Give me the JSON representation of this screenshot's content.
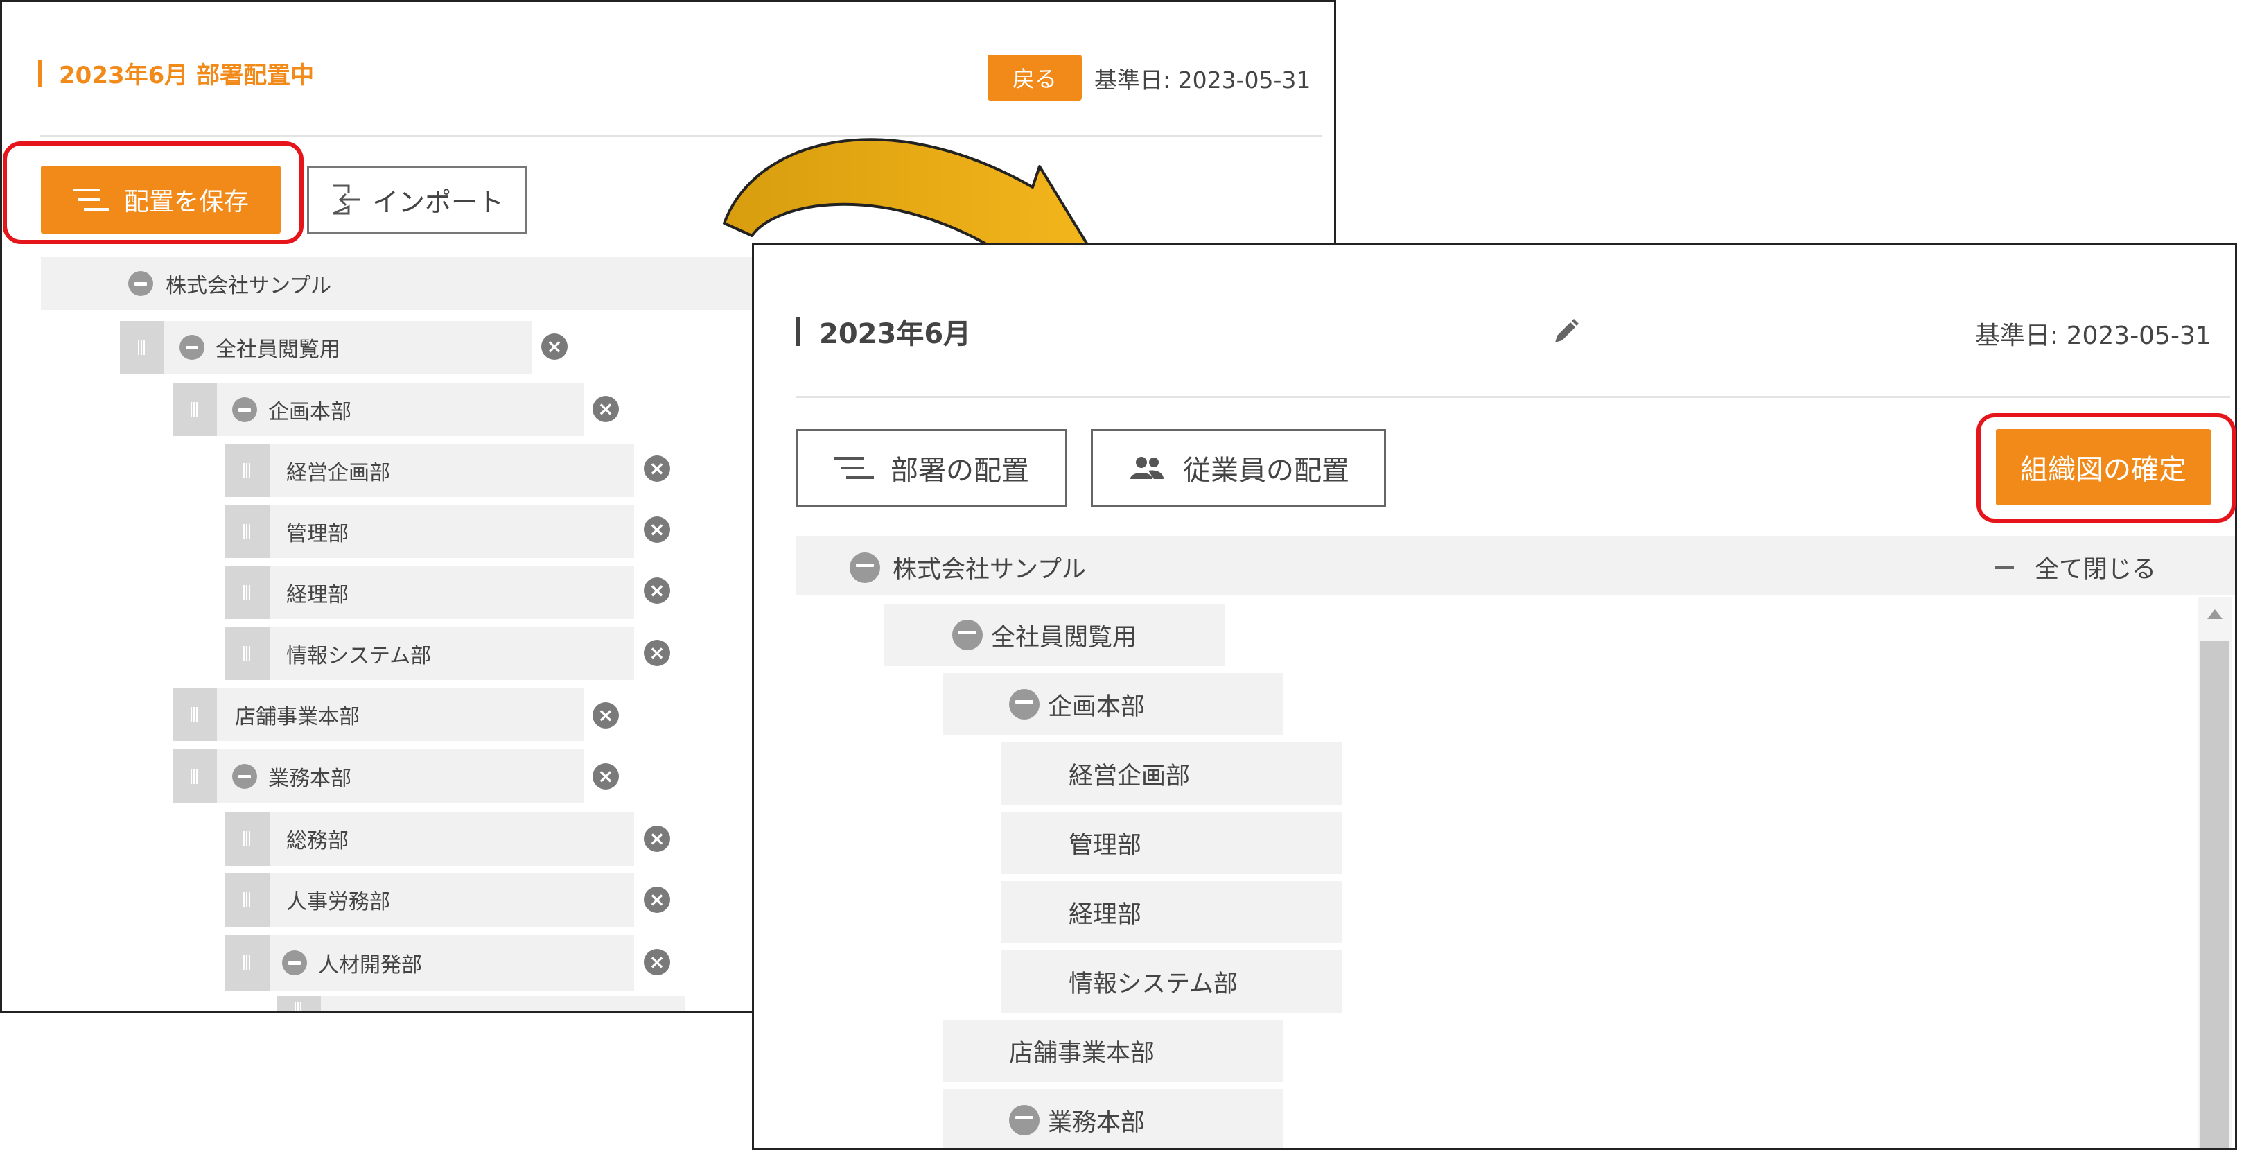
{
  "panel1": {
    "title": "2023年6月 部署配置中",
    "back_label": "戻る",
    "base_date": "基準日: 2023-05-31",
    "save_label": "配置を保存",
    "import_label": "インポート",
    "root": "株式会社サンプル",
    "nodes": [
      "全社員閲覧用",
      "企画本部",
      "経営企画部",
      "管理部",
      "経理部",
      "情報システム部",
      "店舗事業本部",
      "業務本部",
      "総務部",
      "人事労務部",
      "人材開発部"
    ]
  },
  "panel2": {
    "title": "2023年6月",
    "base_date": "基準日: 2023-05-31",
    "dept_label": "部署の配置",
    "emp_label": "従業員の配置",
    "confirm_label": "組織図の確定",
    "root": "株式会社サンプル",
    "collapse_all": "全て閉じる",
    "nodes": [
      "全社員閲覧用",
      "企画本部",
      "経営企画部",
      "管理部",
      "経理部",
      "情報システム部",
      "店舗事業本部",
      "業務本部"
    ]
  },
  "colors": {
    "accent": "#f28a1a",
    "highlight": "#e5151b",
    "arrow": "#e8a912"
  },
  "icons": {
    "list": "list-icon",
    "import": "import-icon",
    "people": "people-icon",
    "edit": "pencil-icon",
    "remove": "remove-icon",
    "collapse": "minus-circle-icon"
  }
}
